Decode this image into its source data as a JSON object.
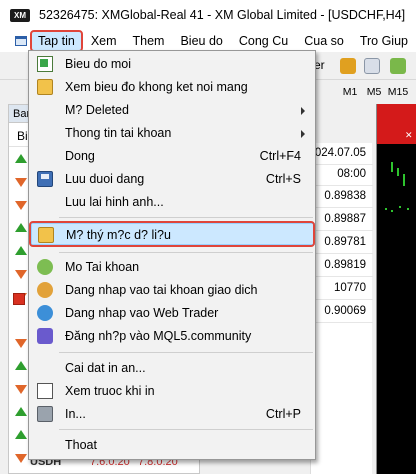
{
  "window": {
    "title": "52326475: XMGlobal-Real 41 - XM Global Limited - [USDCHF,H4]",
    "logo_text": "XM"
  },
  "menubar": {
    "items": [
      "Tap tin",
      "Xem",
      "Them",
      "Bieu do",
      "Cong Cu",
      "Cua so",
      "Tro Giup"
    ]
  },
  "toolbar": {
    "partial_label": "er"
  },
  "timeframes": [
    "M1",
    "M5",
    "M15"
  ],
  "market_watch": {
    "header_partial": "Bar",
    "column_header_partial": "Bi",
    "rows": [
      {
        "dir": "up"
      },
      {
        "dir": "down"
      },
      {
        "dir": "down"
      },
      {
        "dir": "up"
      },
      {
        "dir": "up"
      },
      {
        "dir": "down"
      },
      {
        "dir": "down"
      },
      {
        "dir": "selected"
      },
      {
        "dir": "down"
      },
      {
        "dir": "up"
      },
      {
        "dir": "down"
      },
      {
        "dir": "up"
      },
      {
        "dir": "up"
      },
      {
        "dir": "down"
      },
      {
        "dir": "up"
      },
      {
        "dir": "down"
      }
    ],
    "bottom_symbol": "USDH",
    "bottom_values": [
      "7.6.0.20",
      "7.8.0.20"
    ]
  },
  "data_column": {
    "values": [
      "2024.07.05",
      "08:00",
      "0.89838",
      "0.89887",
      "0.89781",
      "0.89819",
      "10770",
      "0.90069"
    ]
  },
  "file_menu": {
    "items": [
      {
        "label": "Bieu do moi",
        "icon": "new-chart-icon",
        "shortcut": ""
      },
      {
        "label": "Xem bieu đo khong ket noi mang",
        "icon": "open-offline-icon",
        "shortcut": ""
      },
      {
        "label": "M? Deleted",
        "icon": "",
        "shortcut": "",
        "submenu": true
      },
      {
        "label": "Thong tin tai khoan",
        "icon": "",
        "shortcut": "",
        "submenu": true
      },
      {
        "label": "Dong",
        "icon": "",
        "shortcut": "Ctrl+F4"
      },
      {
        "label": "Luu duoi dang",
        "icon": "save-icon",
        "shortcut": "Ctrl+S"
      },
      {
        "label": "Luu lai hinh anh...",
        "icon": "",
        "shortcut": ""
      },
      {
        "label": "M? thý m?c d? li?u",
        "icon": "open-folder-icon",
        "shortcut": "",
        "highlighted": true
      },
      {
        "label": "Mo Tai khoan",
        "icon": "open-account-icon",
        "shortcut": ""
      },
      {
        "label": "Dang nhap vao tai khoan giao dich",
        "icon": "login-trade-icon",
        "shortcut": ""
      },
      {
        "label": "Dang nhap vao Web Trader",
        "icon": "web-trader-icon",
        "shortcut": ""
      },
      {
        "label": "Đăng nh?p vào MQL5.community",
        "icon": "mql5-icon",
        "shortcut": ""
      },
      {
        "label": "Cai dat in an...",
        "icon": "",
        "shortcut": ""
      },
      {
        "label": "Xem truoc khi in",
        "icon": "print-preview-icon",
        "shortcut": ""
      },
      {
        "label": "In...",
        "icon": "print-icon",
        "shortcut": "Ctrl+P"
      },
      {
        "label": "Thoat",
        "icon": "",
        "shortcut": ""
      }
    ]
  },
  "colors": {
    "highlight_outline": "#e0453a",
    "menu_hover": "#cce8ff",
    "chart_background": "#000000",
    "chart_header": "#d41a1a"
  }
}
